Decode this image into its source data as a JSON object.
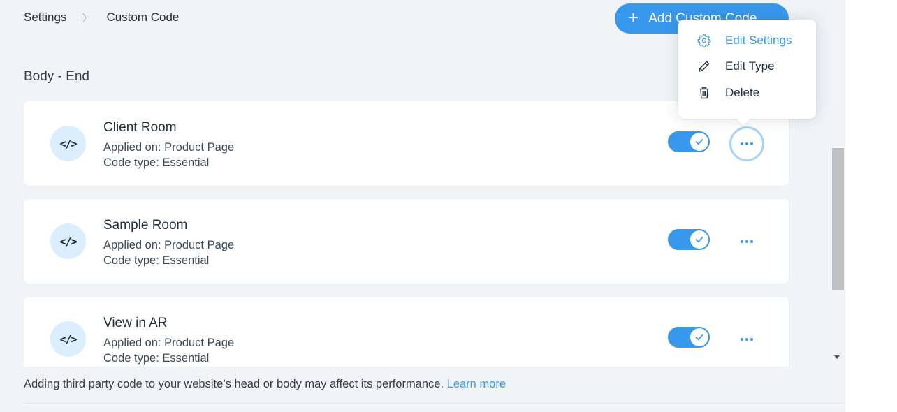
{
  "breadcrumb": {
    "parent": "Settings",
    "separator": "〉",
    "current": "Custom Code"
  },
  "header": {
    "add_button_label": "Add Custom Code",
    "add_button_icon": "plus-icon"
  },
  "section": {
    "title": "Body - End"
  },
  "snippets": [
    {
      "icon_text": "</>",
      "name": "Client Room",
      "applied_on": "Applied on: Product Page",
      "code_type": "Code type: Essential",
      "enabled": true
    },
    {
      "icon_text": "</>",
      "name": "Sample Room",
      "applied_on": "Applied on: Product Page",
      "code_type": "Code type: Essential",
      "enabled": true
    },
    {
      "icon_text": "</>",
      "name": "View in AR",
      "applied_on": "Applied on: Product Page",
      "code_type": "Code type: Essential",
      "enabled": true
    }
  ],
  "context_menu": {
    "items": [
      {
        "label": "Edit Settings",
        "icon": "gear-icon"
      },
      {
        "label": "Edit Type",
        "icon": "pencil-icon"
      },
      {
        "label": "Delete",
        "icon": "trash-icon"
      }
    ]
  },
  "footer": {
    "note": "Adding third party code to your website’s head or body may affect its performance.",
    "link": "Learn more"
  },
  "colors": {
    "accent": "#3899ec",
    "background": "#f0f4f7",
    "icon_circle": "#daeefe"
  }
}
